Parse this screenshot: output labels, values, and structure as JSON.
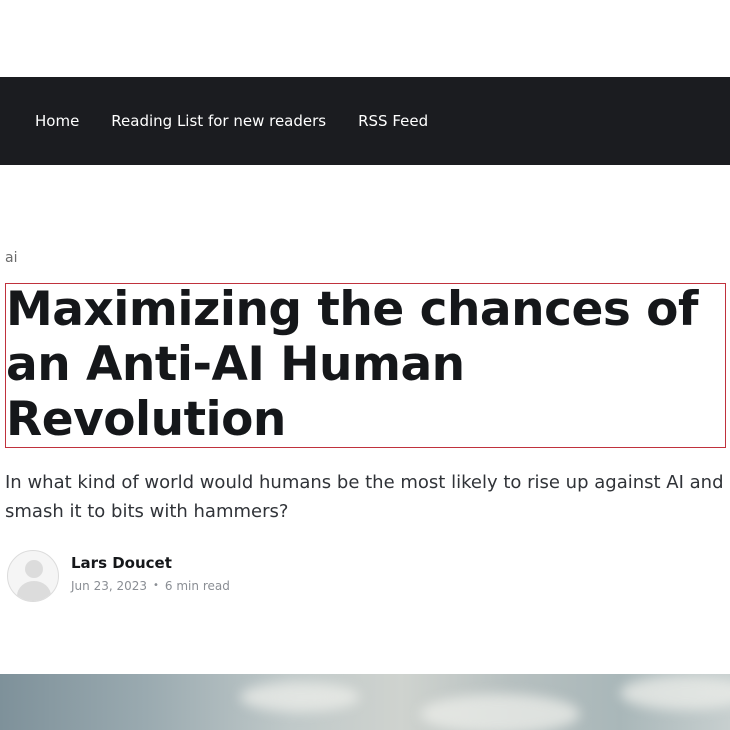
{
  "nav": {
    "items": [
      {
        "label": "Home"
      },
      {
        "label": "Reading List for new readers"
      },
      {
        "label": "RSS Feed"
      }
    ]
  },
  "article": {
    "tag": "ai",
    "title": "Maximizing the chances of an Anti-AI Human Revolution",
    "excerpt": "In what kind of world would humans be the most likely to rise up against AI and smash it to bits with hammers?",
    "author": "Lars Doucet",
    "date": "Jun 23, 2023",
    "separator": "•",
    "read_time": "6 min read"
  },
  "icons": {
    "avatar": "user-avatar-placeholder-icon"
  },
  "colors": {
    "nav_bg": "#1b1c20",
    "title_outline": "#c0323d",
    "meta_text": "#8a8e94"
  }
}
